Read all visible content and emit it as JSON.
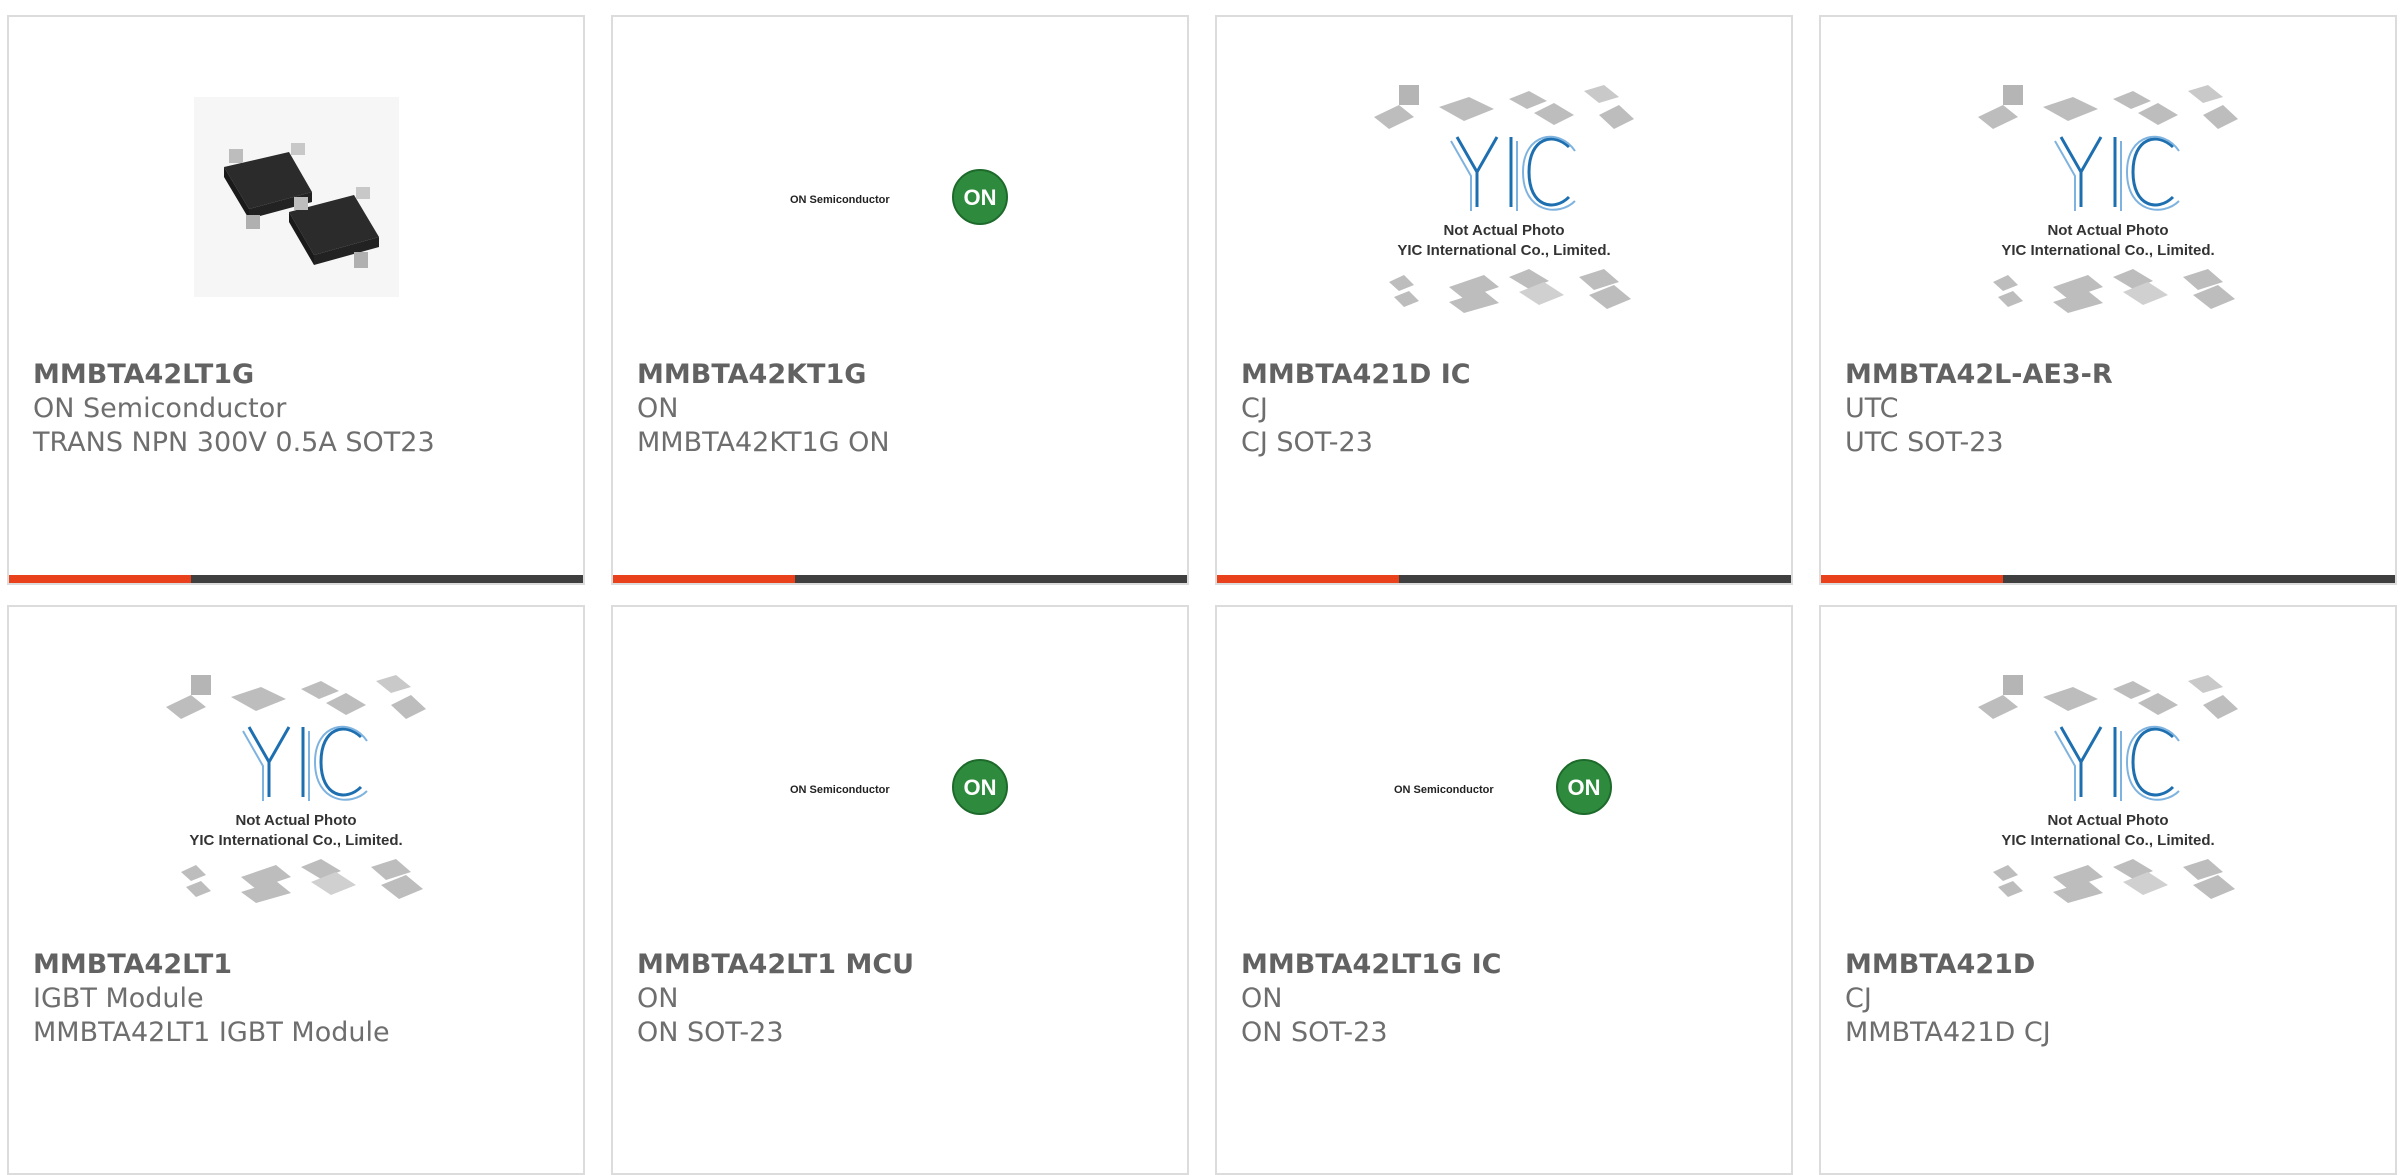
{
  "products": [
    {
      "name": "MMBTA42LT1G",
      "manufacturer": "ON Semiconductor",
      "description": "TRANS NPN 300V 0.5A SOT23",
      "image": "photo"
    },
    {
      "name": "MMBTA42KT1G",
      "manufacturer": "ON",
      "description": "MMBTA42KT1G ON",
      "image": "on-logo"
    },
    {
      "name": "MMBTA421D IC",
      "manufacturer": "CJ",
      "description": "CJ SOT-23",
      "image": "yic-placeholder"
    },
    {
      "name": "MMBTA42L-AE3-R",
      "manufacturer": "UTC",
      "description": "UTC SOT-23",
      "image": "yic-placeholder"
    },
    {
      "name": "MMBTA42LT1",
      "manufacturer": "IGBT Module",
      "description": "MMBTA42LT1 IGBT Module",
      "image": "yic-placeholder"
    },
    {
      "name": "MMBTA42LT1 MCU",
      "manufacturer": "ON",
      "description": "ON SOT-23",
      "image": "on-logo"
    },
    {
      "name": "MMBTA42LT1G IC",
      "manufacturer": "ON",
      "description": "ON SOT-23",
      "image": "on-logo"
    },
    {
      "name": "MMBTA421D",
      "manufacturer": "CJ",
      "description": "MMBTA421D CJ",
      "image": "yic-placeholder"
    }
  ],
  "on_logo": {
    "text": "ON Semiconductor",
    "badge": "ON"
  },
  "yic_placeholder": {
    "logo": "YIC",
    "line1": "Not Actual Photo",
    "line2": "YIC International Co., Limited."
  },
  "colors": {
    "accent": "#e8411b",
    "bar": "#3f3f3f",
    "border": "#dcdcdc",
    "text": "#6e6e6e",
    "on_green": "#2e8b3e",
    "yic_blue": "#1e6fb0"
  }
}
